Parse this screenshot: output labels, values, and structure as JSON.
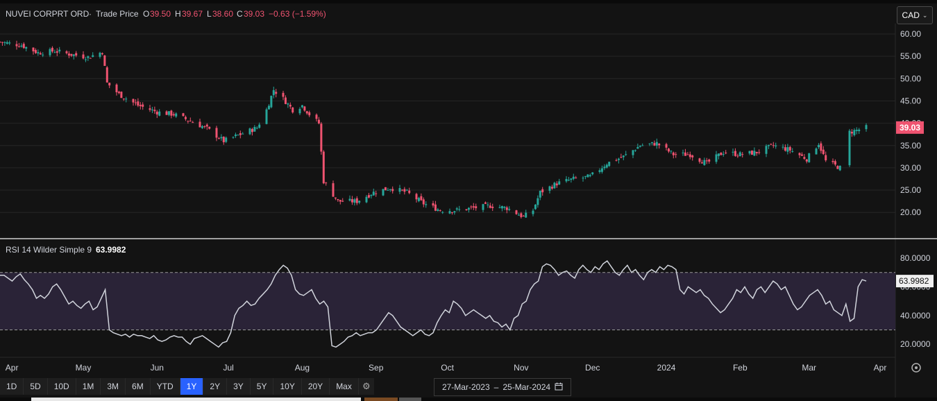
{
  "header": {
    "title": "NUVEI CORPRT ORD",
    "sep": "·",
    "subtitle": "Trade Price",
    "o_label": "O",
    "o_value": "39.50",
    "h_label": "H",
    "h_value": "39.67",
    "l_label": "L",
    "l_value": "38.60",
    "c_label": "C",
    "c_value": "39.03",
    "change": "−0.63 (−1.59%)"
  },
  "currency": {
    "label": "CAD"
  },
  "rsi_header": {
    "label": "RSI 14 Wilder Simple 9",
    "value": "63.9982"
  },
  "price_axis": {
    "ticks": [
      "60.00",
      "55.00",
      "50.00",
      "45.00",
      "40.00",
      "35.00",
      "30.00",
      "25.00",
      "20.00"
    ],
    "last_price": "39.03"
  },
  "rsi_axis": {
    "ticks": [
      "80.0000",
      "60.0000",
      "40.0000",
      "20.0000"
    ],
    "last_value": "63.9982"
  },
  "time_axis": {
    "labels": [
      "Apr",
      "May",
      "Jun",
      "Jul",
      "Aug",
      "Sep",
      "Oct",
      "Nov",
      "Dec",
      "2024",
      "Feb",
      "Mar",
      "Apr"
    ]
  },
  "range_buttons": [
    "1D",
    "5D",
    "10D",
    "1M",
    "3M",
    "6M",
    "YTD",
    "1Y",
    "2Y",
    "3Y",
    "5Y",
    "10Y",
    "20Y",
    "Max"
  ],
  "active_range": "1Y",
  "date_range": {
    "start": "27-Mar-2023",
    "sep": "–",
    "end": "25-Mar-2024"
  },
  "colors": {
    "up": "#26a69a",
    "down": "#ef5370",
    "rsi_line": "#d1d4dc",
    "rsi_band": "#2a2337",
    "active": "#2962ff"
  },
  "chart_data": [
    {
      "type": "candlestick",
      "title": "NUVEI CORPRT ORD · Trade Price",
      "x_range": [
        "27-Mar-2023",
        "25-Mar-2024"
      ],
      "ylim": [
        15,
        62
      ],
      "close_points": [
        [
          "27-Mar-2023",
          58.2
        ],
        [
          "05-Apr-2023",
          57.5
        ],
        [
          "12-Apr-2023",
          55.8
        ],
        [
          "19-Apr-2023",
          56.2
        ],
        [
          "26-Apr-2023",
          55.4
        ],
        [
          "03-May-2023",
          54.8
        ],
        [
          "09-May-2023",
          56.0
        ],
        [
          "11-May-2023",
          49.0
        ],
        [
          "16-May-2023",
          46.5
        ],
        [
          "24-May-2023",
          44.0
        ],
        [
          "01-Jun-2023",
          42.5
        ],
        [
          "08-Jun-2023",
          42.0
        ],
        [
          "15-Jun-2023",
          40.5
        ],
        [
          "22-Jun-2023",
          38.8
        ],
        [
          "29-Jun-2023",
          36.0
        ],
        [
          "06-Jul-2023",
          37.5
        ],
        [
          "13-Jul-2023",
          39.0
        ],
        [
          "17-Jul-2023",
          43.0
        ],
        [
          "20-Jul-2023",
          47.5
        ],
        [
          "24-Jul-2023",
          45.5
        ],
        [
          "28-Jul-2023",
          43.0
        ],
        [
          "01-Aug-2023",
          44.0
        ],
        [
          "04-Aug-2023",
          42.0
        ],
        [
          "08-Aug-2023",
          40.0
        ],
        [
          "10-Aug-2023",
          27.0
        ],
        [
          "16-Aug-2023",
          22.5
        ],
        [
          "24-Aug-2023",
          22.5
        ],
        [
          "31-Aug-2023",
          24.5
        ],
        [
          "07-Sep-2023",
          25.5
        ],
        [
          "14-Sep-2023",
          24.5
        ],
        [
          "21-Sep-2023",
          22.0
        ],
        [
          "28-Sep-2023",
          20.5
        ],
        [
          "05-Oct-2023",
          20.5
        ],
        [
          "12-Oct-2023",
          21.0
        ],
        [
          "19-Oct-2023",
          21.5
        ],
        [
          "26-Oct-2023",
          21.0
        ],
        [
          "02-Nov-2023",
          19.0
        ],
        [
          "06-Nov-2023",
          20.5
        ],
        [
          "09-Nov-2023",
          24.5
        ],
        [
          "16-Nov-2023",
          26.5
        ],
        [
          "23-Nov-2023",
          27.5
        ],
        [
          "30-Nov-2023",
          28.0
        ],
        [
          "07-Dec-2023",
          31.0
        ],
        [
          "14-Dec-2023",
          32.5
        ],
        [
          "21-Dec-2023",
          35.0
        ],
        [
          "28-Dec-2023",
          35.5
        ],
        [
          "04-Jan-2024",
          33.0
        ],
        [
          "11-Jan-2024",
          33.0
        ],
        [
          "18-Jan-2024",
          31.0
        ],
        [
          "25-Jan-2024",
          33.5
        ],
        [
          "01-Feb-2024",
          33.0
        ],
        [
          "08-Feb-2024",
          33.5
        ],
        [
          "15-Feb-2024",
          35.0
        ],
        [
          "22-Feb-2024",
          34.0
        ],
        [
          "29-Feb-2024",
          32.0
        ],
        [
          "05-Mar-2024",
          35.5
        ],
        [
          "08-Mar-2024",
          31.5
        ],
        [
          "14-Mar-2024",
          30.0
        ],
        [
          "18-Mar-2024",
          38.0
        ],
        [
          "25-Mar-2024",
          39.03
        ]
      ]
    },
    {
      "type": "line",
      "title": "RSI 14 Wilder Simple 9",
      "x_range": [
        "27-Mar-2023",
        "25-Mar-2024"
      ],
      "ylim": [
        15,
        85
      ],
      "band": [
        30,
        70
      ],
      "values": [
        68,
        68,
        66,
        64,
        67,
        69,
        65,
        62,
        58,
        52,
        54,
        52,
        55,
        60,
        62,
        58,
        53,
        48,
        50,
        47,
        45,
        48,
        50,
        44,
        46,
        52,
        58,
        30,
        28,
        27,
        26,
        27,
        25,
        27,
        26,
        26,
        25,
        24,
        26,
        23,
        22,
        23,
        25,
        26,
        25,
        25,
        22,
        20,
        24,
        25,
        26,
        24,
        22,
        20,
        18,
        21,
        22,
        28,
        40,
        45,
        47,
        50,
        47,
        48,
        52,
        55,
        58,
        62,
        68,
        72,
        75,
        73,
        68,
        58,
        55,
        54,
        56,
        58,
        52,
        48,
        50,
        46,
        19,
        18,
        20,
        22,
        25,
        26,
        28,
        26,
        27,
        28,
        28,
        30,
        34,
        38,
        42,
        40,
        36,
        32,
        30,
        28,
        26,
        28,
        30,
        27,
        26,
        28,
        35,
        40,
        44,
        42,
        50,
        48,
        45,
        40,
        42,
        44,
        42,
        40,
        38,
        40,
        36,
        35,
        32,
        34,
        30,
        38,
        40,
        48,
        50,
        58,
        62,
        64,
        74,
        76,
        75,
        72,
        68,
        70,
        71,
        68,
        66,
        72,
        75,
        72,
        70,
        74,
        72,
        76,
        78,
        74,
        70,
        68,
        72,
        75,
        70,
        72,
        68,
        65,
        70,
        72,
        70,
        74,
        72,
        75,
        74,
        72,
        58,
        55,
        60,
        58,
        56,
        58,
        54,
        52,
        48,
        45,
        42,
        44,
        48,
        52,
        58,
        56,
        60,
        55,
        52,
        58,
        60,
        56,
        60,
        64,
        62,
        58,
        60,
        54,
        48,
        44,
        46,
        50,
        54,
        56,
        58,
        54,
        48,
        50,
        44,
        42,
        40,
        48,
        36,
        38,
        60,
        65,
        64
      ]
    }
  ]
}
